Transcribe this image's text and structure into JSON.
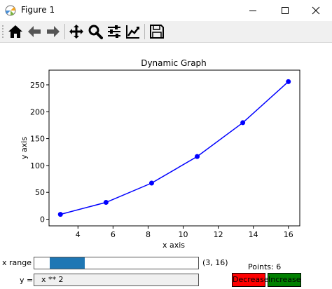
{
  "window": {
    "title": "Figure 1"
  },
  "toolbar": {
    "tools": [
      "home-icon",
      "back-icon",
      "forward-icon",
      "pan-icon",
      "zoom-icon",
      "subplots-config-icon",
      "edit-axis-icon",
      "save-icon"
    ]
  },
  "colors": {
    "line": "#0000ff",
    "slider_fill": "#1f77b4",
    "decrease_bg": "#ff0000",
    "increase_bg": "#008000"
  },
  "chart_data": {
    "type": "line",
    "title": "Dynamic Graph",
    "xlabel": "x axis",
    "ylabel": "y axis",
    "x": [
      3,
      5.6,
      8.2,
      10.8,
      13.4,
      16
    ],
    "series": [
      {
        "values": [
          9,
          31.36,
          67.24,
          116.64,
          179.56,
          256
        ]
      }
    ],
    "xlim": [
      2.35,
      16.65
    ],
    "ylim": [
      -12.35,
      277.35
    ],
    "xticks": [
      "4",
      "6",
      "8",
      "10",
      "12",
      "14",
      "16"
    ],
    "xtick_values": [
      4,
      6,
      8,
      10,
      12,
      14,
      16
    ],
    "yticks": [
      "0",
      "50",
      "100",
      "150",
      "200",
      "250"
    ],
    "ytick_values": [
      0,
      50,
      100,
      150,
      200,
      250
    ],
    "grid": false
  },
  "controls": {
    "x_range_label": "x range",
    "x_range_value": "(3, 16)",
    "x_range_slider": {
      "min": 2.3,
      "max": 16.6,
      "low": 3,
      "high": 6
    },
    "y_label": "y =",
    "y_expression": "x ** 2",
    "points_label": "Points: 6",
    "decrease_label": "Decrease",
    "increase_label": "Increase"
  }
}
